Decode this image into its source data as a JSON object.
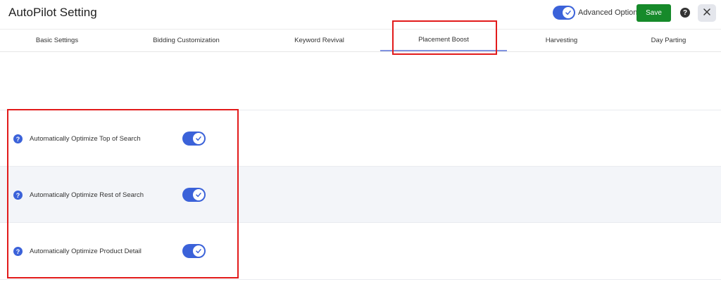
{
  "header": {
    "title": "AutoPilot Setting",
    "advanced_options_label": "Advanced Options",
    "advanced_options_enabled": true,
    "save_label": "Save",
    "help_glyph": "?",
    "close_icon": "close-icon"
  },
  "tabs": [
    {
      "label": "Basic Settings",
      "active": false
    },
    {
      "label": "Bidding Customization",
      "active": false
    },
    {
      "label": "Keyword Revival",
      "active": false
    },
    {
      "label": "Placement Boost",
      "active": true
    },
    {
      "label": "Harvesting",
      "active": false
    },
    {
      "label": "Day Parting",
      "active": false
    }
  ],
  "settings": [
    {
      "label": "Automatically Optimize Top of Search",
      "enabled": true
    },
    {
      "label": "Automatically Optimize Rest of Search",
      "enabled": true
    },
    {
      "label": "Automatically Optimize Product Detail",
      "enabled": true
    }
  ],
  "colors": {
    "accent": "#3b62d9",
    "save": "#168a2a",
    "highlight": "#e21b1b",
    "row_shade": "#f3f5f9"
  }
}
